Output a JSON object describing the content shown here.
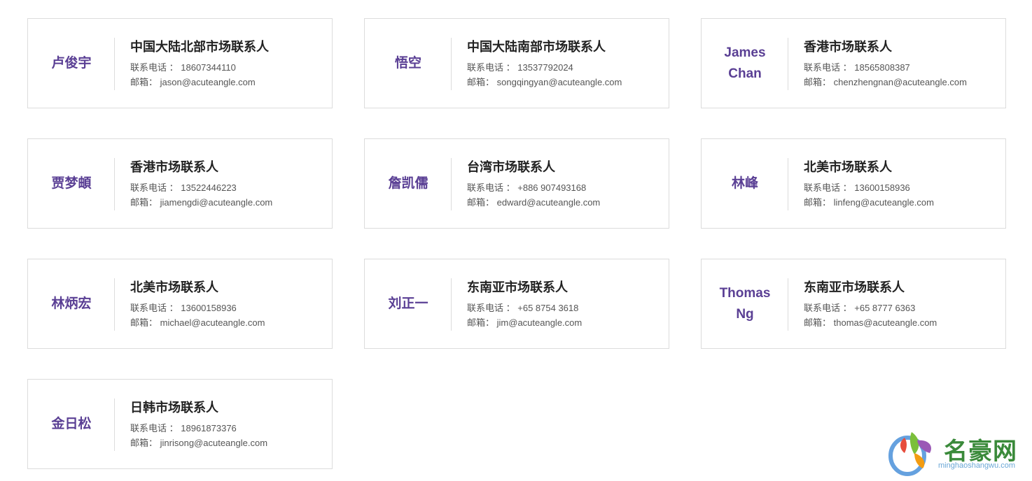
{
  "contacts": [
    {
      "name": "卢俊宇",
      "role": "中国大陆北部市场联系人",
      "phone_label": "联系电话 ：",
      "phone": "18607344110",
      "email_label": "邮箱：",
      "email": "jason@acuteangle.com"
    },
    {
      "name": "悟空",
      "role": "中国大陆南部市场联系人",
      "phone_label": "联系电话 ：",
      "phone": "13537792024",
      "email_label": "邮箱：",
      "email": "songqingyan@acuteangle.com"
    },
    {
      "name": "James Chan",
      "role": "香港市场联系人",
      "phone_label": "联系电话 ：",
      "phone": "18565808387",
      "email_label": "邮箱：",
      "email": "chenzhengnan@acuteangle.com"
    },
    {
      "name": "贾梦頔",
      "role": "香港市场联系人",
      "phone_label": "联系电话 ：",
      "phone": "13522446223",
      "email_label": "邮箱：",
      "email": "jiamengdi@acuteangle.com"
    },
    {
      "name": "詹凯儒",
      "role": "台湾市场联系人",
      "phone_label": "联系电话 ：",
      "phone": "+886 907493168",
      "email_label": "邮箱：",
      "email": "edward@acuteangle.com"
    },
    {
      "name": "林峰",
      "role": "北美市场联系人",
      "phone_label": "联系电话 ：",
      "phone": "13600158936",
      "email_label": "邮箱：",
      "email": "linfeng@acuteangle.com"
    },
    {
      "name": "林炳宏",
      "role": "北美市场联系人",
      "phone_label": "联系电话 ：",
      "phone": "13600158936",
      "email_label": "邮箱：",
      "email": "michael@acuteangle.com"
    },
    {
      "name": "刘正一",
      "role": "东南亚市场联系人",
      "phone_label": "联系电话 ：",
      "phone": "+65 8754 3618",
      "email_label": "邮箱：",
      "email": "jim@acuteangle.com"
    },
    {
      "name": "Thomas Ng",
      "role": "东南亚市场联系人",
      "phone_label": "联系电话 ：",
      "phone": "+65 8777 6363",
      "email_label": "邮箱：",
      "email": "thomas@acuteangle.com"
    },
    {
      "name": "金日松",
      "role": "日韩市场联系人",
      "phone_label": "联系电话 ：",
      "phone": "18961873376",
      "email_label": "邮箱：",
      "email": "jinrisong@acuteangle.com"
    }
  ],
  "watermark": {
    "text": "名豪网",
    "subtext": "minghaoshangwu.com"
  },
  "colors": {
    "name": "#5a3f94",
    "border": "#dcdcdc",
    "role": "#222222",
    "text": "#555555"
  }
}
